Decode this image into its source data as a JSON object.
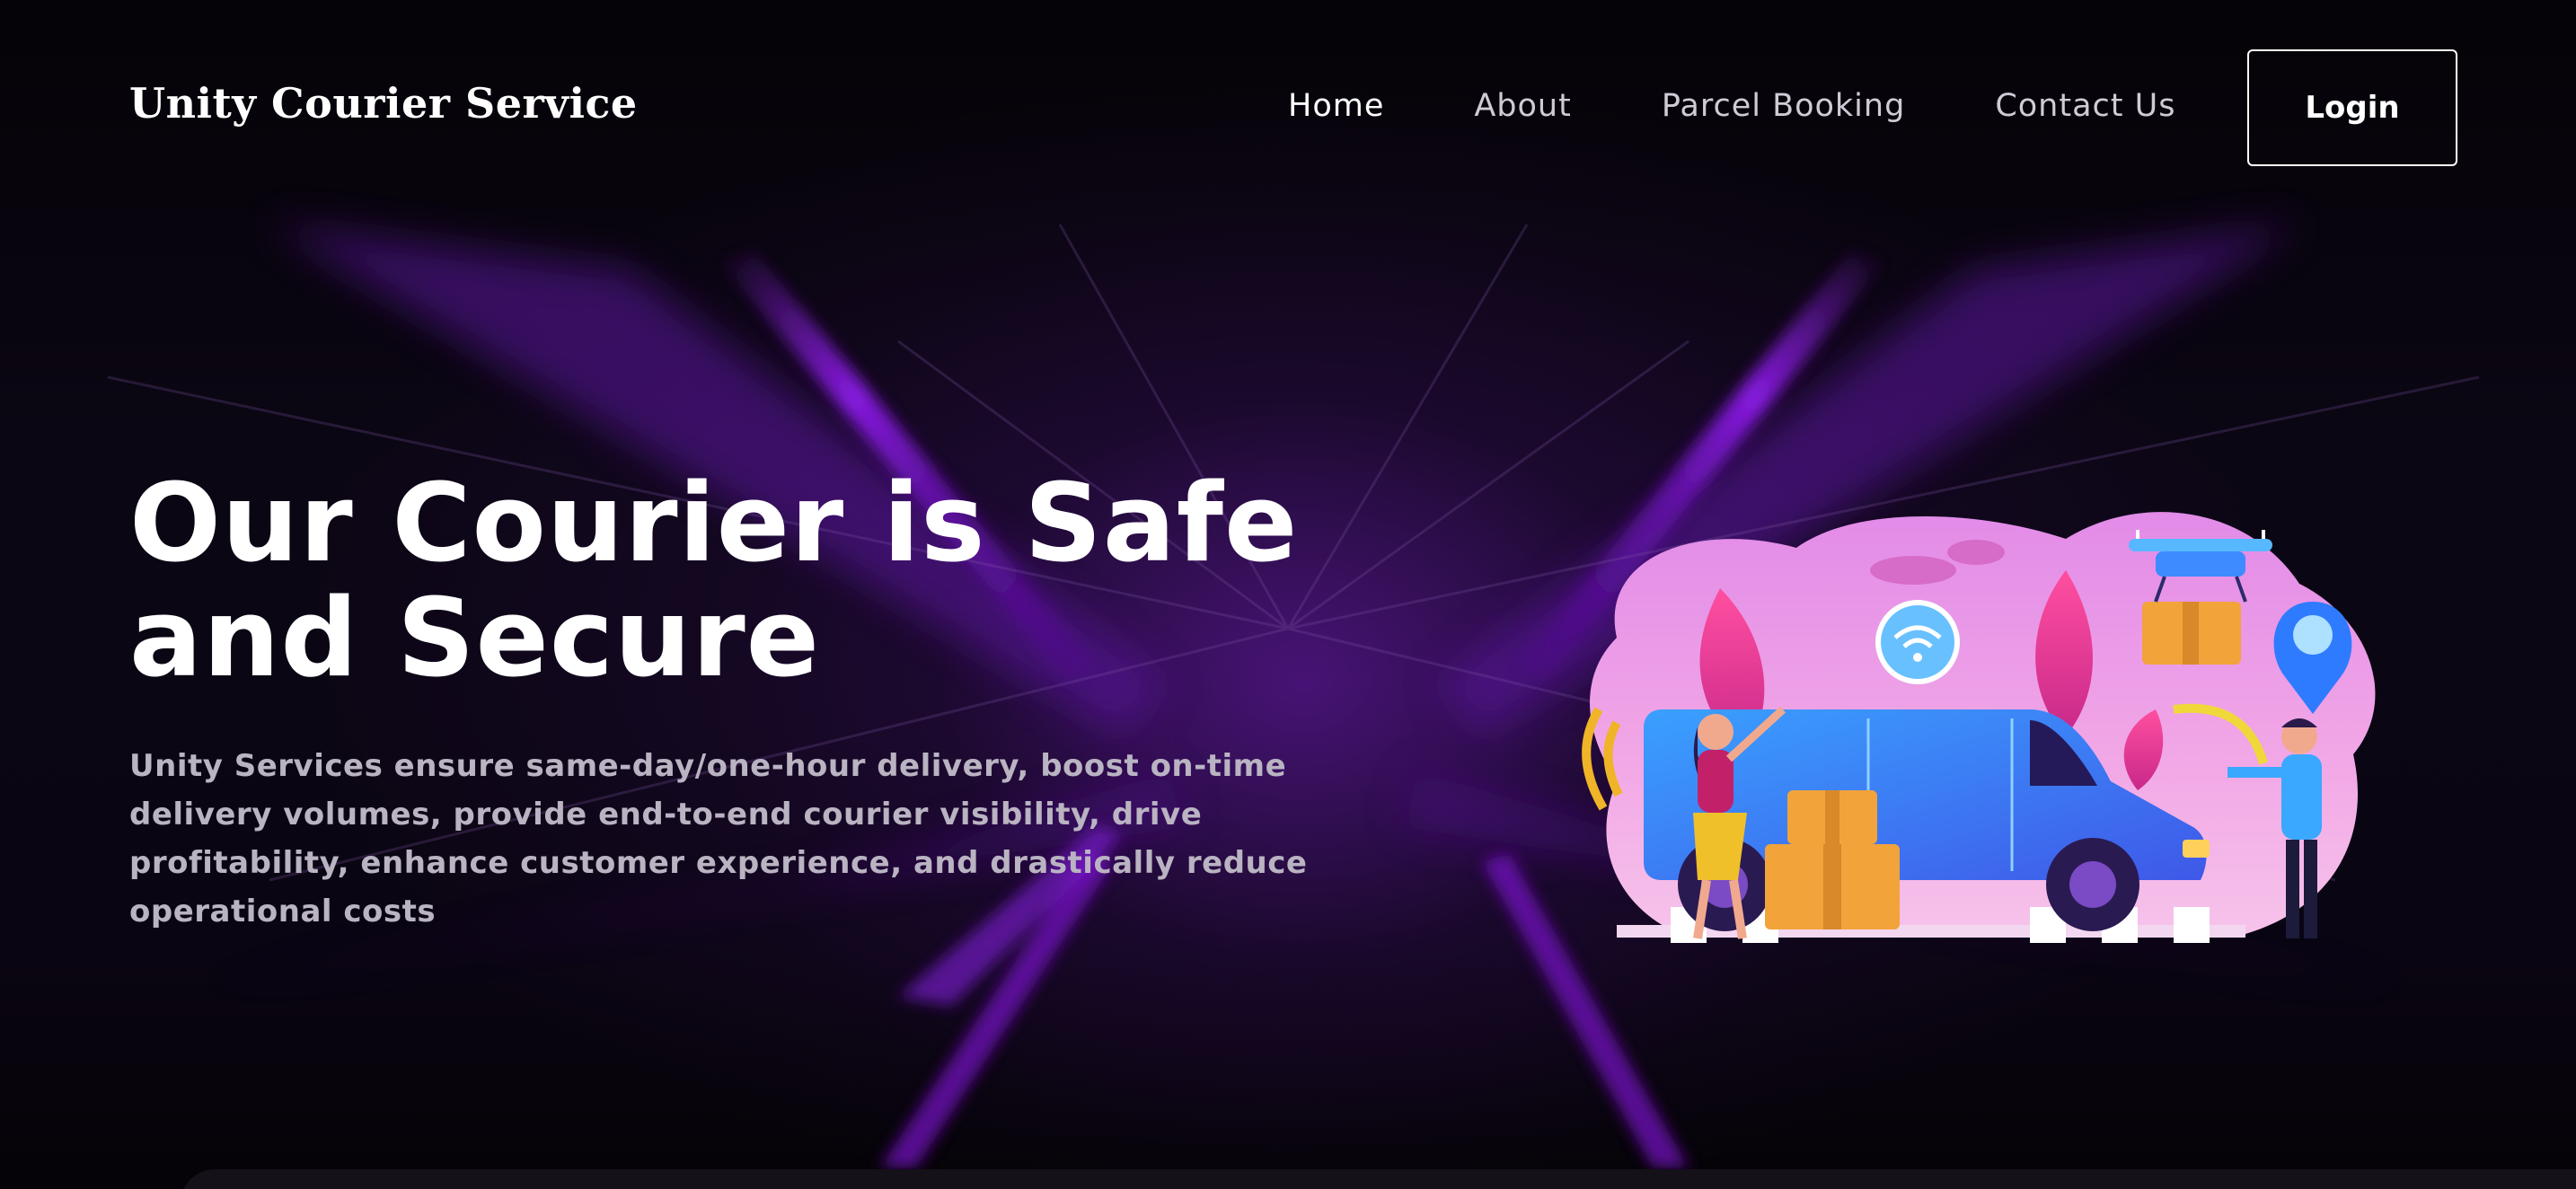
{
  "brand": {
    "name": "Unity Courier Service"
  },
  "nav": {
    "items": [
      {
        "label": "Home",
        "active": true
      },
      {
        "label": "About",
        "active": false
      },
      {
        "label": "Parcel Booking",
        "active": false
      },
      {
        "label": "Contact Us",
        "active": false
      }
    ],
    "login_label": "Login"
  },
  "hero": {
    "title": "Our Courier is Safe and Secure",
    "description": "Unity Services ensure same-day/one-hour delivery, boost on-time delivery volumes, provide end-to-end courier visibility, drive profitability, enhance customer experience, and drastically reduce operational costs"
  },
  "colors": {
    "background": "#07040c",
    "accent_purple": "#8a1fe0",
    "text_primary": "#ffffff",
    "text_secondary": "#b9b3c2"
  },
  "icons": {
    "illustration": "courier-van-illustration",
    "wifi": "wifi-icon",
    "location": "location-pin-icon",
    "drone": "drone-icon"
  }
}
